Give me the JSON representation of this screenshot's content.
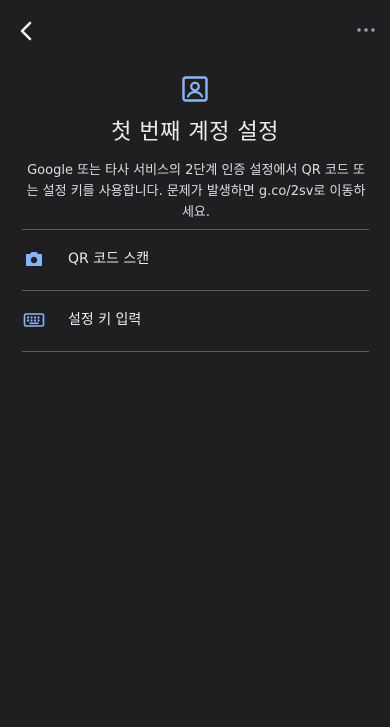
{
  "header": {
    "back_icon": "chevron-left-icon",
    "more_icon": "more-horizontal-icon"
  },
  "hero": {
    "icon": "account-box-icon",
    "title": "첫 번째 계정 설정",
    "description": "Google 또는 타사 서비스의 2단계 인증 설정에서 QR 코드 또는 설정 키를 사용합니다. 문제가 발생하면 g.co/2sv로 이동하세요."
  },
  "options": [
    {
      "icon": "camera-icon",
      "label": "QR 코드 스캔"
    },
    {
      "icon": "keyboard-icon",
      "label": "설정 키 입력"
    }
  ],
  "colors": {
    "background": "#1f1f21",
    "accent": "#8ab4f8",
    "text": "#e8eaed",
    "divider": "#5a5b5e"
  }
}
